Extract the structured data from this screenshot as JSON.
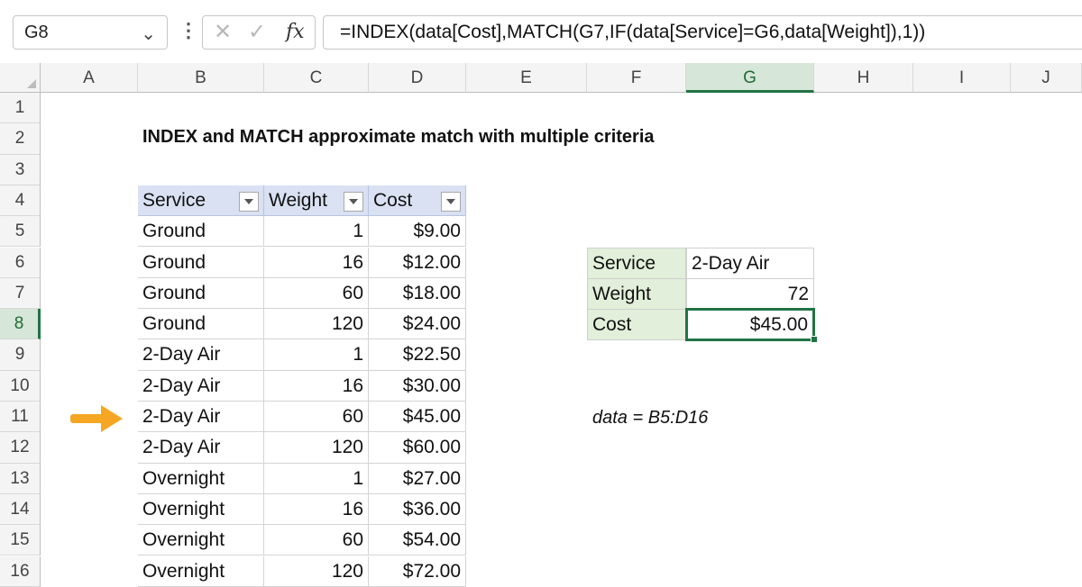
{
  "formula_bar": {
    "name_box": "G8",
    "formula": "=INDEX(data[Cost],MATCH(G7,IF(data[Service]=G6,data[Weight]),1))"
  },
  "icons": [
    "chevron-down-icon",
    "more-vertical-icon",
    "cancel-x-icon",
    "confirm-check-icon",
    "function-fx-icon",
    "arrow-right-icon"
  ],
  "columns": [
    "A",
    "B",
    "C",
    "D",
    "E",
    "F",
    "G",
    "H",
    "I",
    "J"
  ],
  "selected_column": "G",
  "rows": [
    "1",
    "2",
    "3",
    "4",
    "5",
    "6",
    "7",
    "8",
    "9",
    "10",
    "11",
    "12",
    "13",
    "14",
    "15",
    "16"
  ],
  "selected_row": "8",
  "sheet": {
    "title": "INDEX and MATCH approximate match with multiple criteria",
    "table": {
      "headers": [
        "Service",
        "Weight",
        "Cost"
      ],
      "rows": [
        [
          "Ground",
          "1",
          "$9.00"
        ],
        [
          "Ground",
          "16",
          "$12.00"
        ],
        [
          "Ground",
          "60",
          "$18.00"
        ],
        [
          "Ground",
          "120",
          "$24.00"
        ],
        [
          "2-Day Air",
          "1",
          "$22.50"
        ],
        [
          "2-Day Air",
          "16",
          "$30.00"
        ],
        [
          "2-Day Air",
          "60",
          "$45.00"
        ],
        [
          "2-Day Air",
          "120",
          "$60.00"
        ],
        [
          "Overnight",
          "1",
          "$27.00"
        ],
        [
          "Overnight",
          "16",
          "$36.00"
        ],
        [
          "Overnight",
          "60",
          "$54.00"
        ],
        [
          "Overnight",
          "120",
          "$72.00"
        ]
      ]
    },
    "lookup": {
      "service_label": "Service",
      "service_value": "2-Day Air",
      "weight_label": "Weight",
      "weight_value": "72",
      "cost_label": "Cost",
      "cost_value": "$45.00"
    },
    "named_range_note": "data = B5:D16"
  },
  "colors": {
    "accent_green": "#217346",
    "table_header_blue": "#d9e1f2",
    "label_green": "#e2efda",
    "arrow_orange": "#f5a623"
  }
}
